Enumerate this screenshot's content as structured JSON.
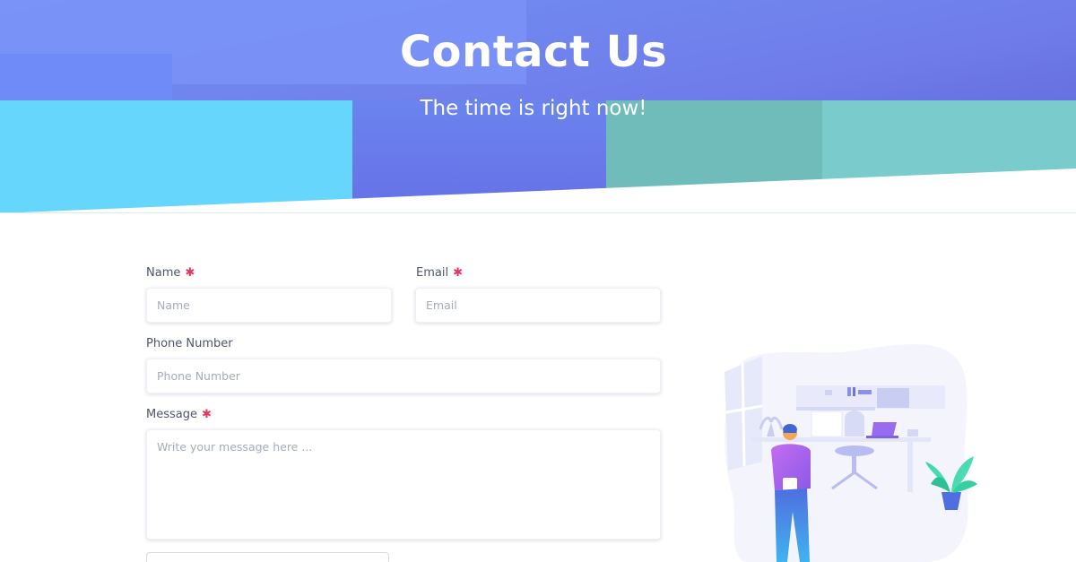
{
  "hero": {
    "title": "Contact Us",
    "subtitle": "The time is right now!"
  },
  "form": {
    "name": {
      "label": "Name",
      "required": true,
      "placeholder": "Name",
      "value": ""
    },
    "email": {
      "label": "Email",
      "required": true,
      "placeholder": "Email",
      "value": ""
    },
    "phone": {
      "label": "Phone Number",
      "required": false,
      "placeholder": "Phone Number",
      "value": ""
    },
    "message": {
      "label": "Message",
      "required": true,
      "placeholder": "Write your message here ...",
      "value": ""
    },
    "required_marker": "✱"
  },
  "icons": {
    "required": "asterisk-icon",
    "illustration": "office-person-illustration"
  },
  "colors": {
    "hero_blue": "#6b79e8",
    "hero_cyan": "#66d6fc",
    "hero_teal": "#78c9c8",
    "required": "#e8345d",
    "placeholder": "#a6abbe",
    "label": "#4f5572"
  }
}
